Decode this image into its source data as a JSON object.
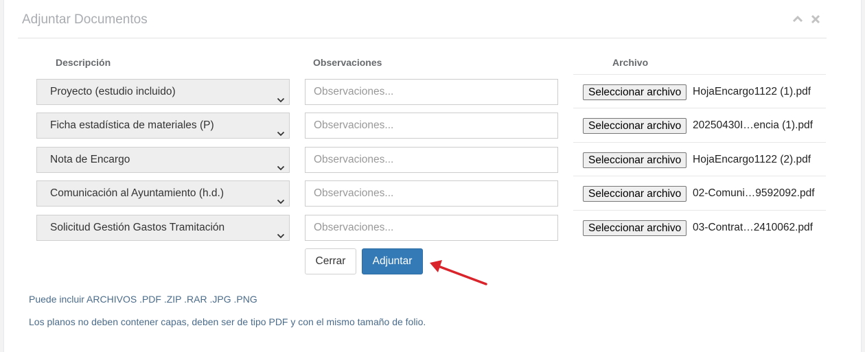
{
  "panel": {
    "title": "Adjuntar Documentos"
  },
  "columns": {
    "descripcion": "Descripción",
    "observaciones": "Observaciones",
    "archivo": "Archivo"
  },
  "rows": [
    {
      "descripcion": "Proyecto (estudio incluido)",
      "observaciones_placeholder": "Observaciones...",
      "file_button": "Seleccionar archivo",
      "file_name": "HojaEncargo1122 (1).pdf"
    },
    {
      "descripcion": "Ficha estadística de materiales (P)",
      "observaciones_placeholder": "Observaciones...",
      "file_button": "Seleccionar archivo",
      "file_name": "20250430I…encia (1).pdf"
    },
    {
      "descripcion": "Nota de Encargo",
      "observaciones_placeholder": "Observaciones...",
      "file_button": "Seleccionar archivo",
      "file_name": "HojaEncargo1122 (2).pdf"
    },
    {
      "descripcion": "Comunicación al Ayuntamiento (h.d.)",
      "observaciones_placeholder": "Observaciones...",
      "file_button": "Seleccionar archivo",
      "file_name": "02-Comuni…9592092.pdf"
    },
    {
      "descripcion": "Solicitud Gestión Gastos Tramitación",
      "observaciones_placeholder": "Observaciones...",
      "file_button": "Seleccionar archivo",
      "file_name": "03-Contrat…2410062.pdf"
    }
  ],
  "actions": {
    "cerrar": "Cerrar",
    "adjuntar": "Adjuntar"
  },
  "notes": {
    "formats": "Puede incluir ARCHIVOS .PDF .ZIP .RAR .JPG .PNG",
    "planos": "Los planos no deben contener capas, deben ser de tipo PDF y con el mismo tamaño de folio."
  },
  "colors": {
    "primary": "#337ab7",
    "annotation_arrow": "#d9242b"
  },
  "icons": {
    "collapse": "chevron-up-icon",
    "close": "close-icon",
    "select": "chevron-down-icon",
    "pointer": "red-arrow-icon"
  }
}
